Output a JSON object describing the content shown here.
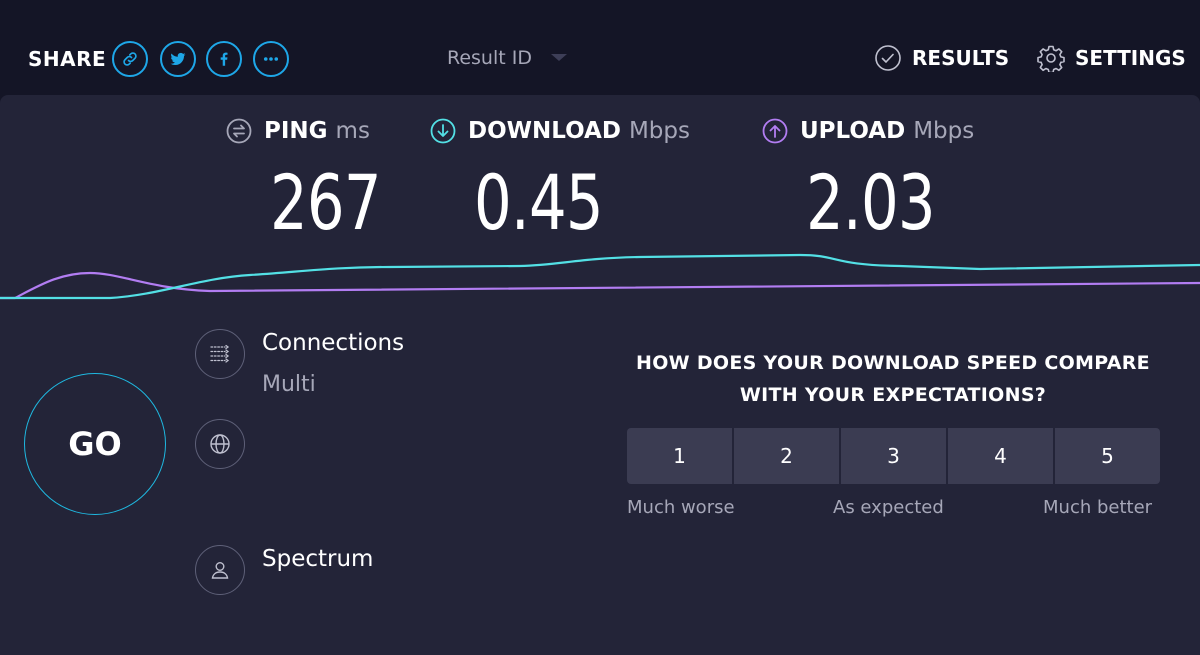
{
  "header": {
    "share_label": "SHARE",
    "share_icons": [
      "link-icon",
      "twitter-icon",
      "facebook-icon",
      "more-icon"
    ],
    "result_id_label": "Result ID",
    "results_label": "RESULTS",
    "settings_label": "SETTINGS"
  },
  "metrics": {
    "ping": {
      "label": "PING",
      "unit": "ms",
      "value": "267",
      "icon": "ping-icon",
      "color": "#a6a7b8"
    },
    "download": {
      "label": "DOWNLOAD",
      "unit": "Mbps",
      "value": "0.45",
      "icon": "download-arrow-icon",
      "color": "#53e0e5"
    },
    "upload": {
      "label": "UPLOAD",
      "unit": "Mbps",
      "value": "2.03",
      "icon": "upload-arrow-icon",
      "color": "#b27df2"
    }
  },
  "graph": {
    "download_color": "#53e0e5",
    "upload_color": "#b27df2"
  },
  "go_label": "GO",
  "connection": {
    "title": "Connections",
    "mode": "Multi",
    "provider": "Spectrum"
  },
  "survey": {
    "question_line1": "HOW DOES YOUR DOWNLOAD SPEED COMPARE",
    "question_line2": "WITH YOUR EXPECTATIONS?",
    "options": [
      "1",
      "2",
      "3",
      "4",
      "5"
    ],
    "label_low": "Much worse",
    "label_mid": "As expected",
    "label_high": "Much better"
  },
  "colors": {
    "background": "#141526",
    "panel": "#232438",
    "accent": "#1ea7e8",
    "button": "#3b3c52"
  }
}
